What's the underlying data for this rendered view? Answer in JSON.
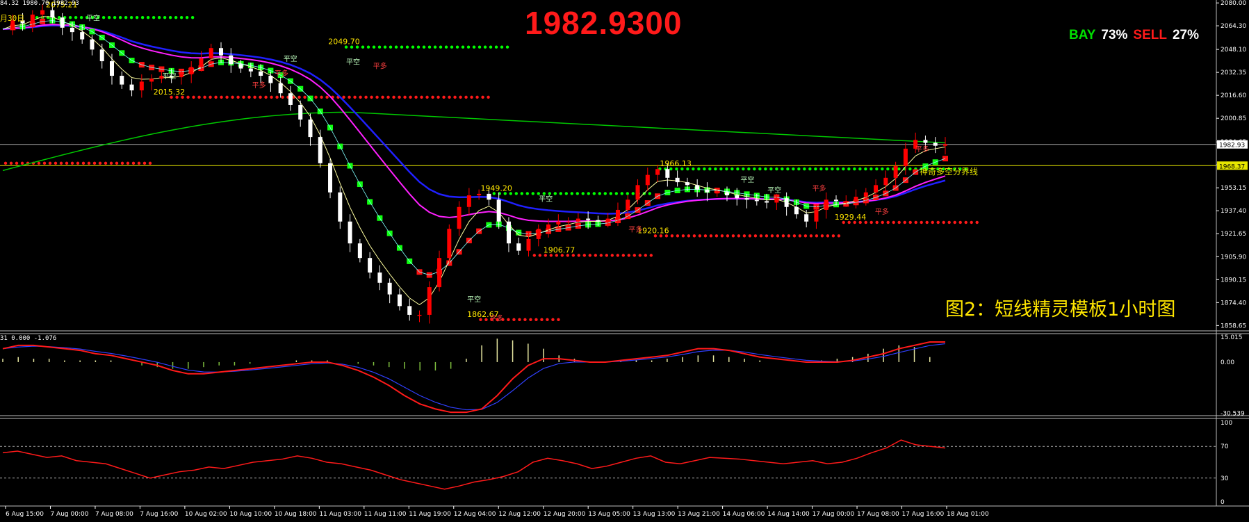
{
  "header": {
    "ohlc_text": "84.32 1980.70 1982.93",
    "date_fragment": "月30日",
    "macd_text": "31 0.000 -1.076"
  },
  "big_price": "1982.9300",
  "sentiment": {
    "buy_label": "BAY",
    "buy_pct": "73%",
    "sell_label": "SELL",
    "sell_pct": "27%",
    "buy_color": "#00e000",
    "sell_color": "#ff1a1a"
  },
  "caption": "图2：短线精灵模板1小时图",
  "colors": {
    "bull": "#ff0000",
    "bear": "#ffffff",
    "grid": "#ffffff",
    "support_dots": "#ff1a1a",
    "resist_dots": "#00ff00",
    "ma_long": "#00c800",
    "ma_blue": "#2020ff",
    "ma_magenta": "#ff20ff",
    "label_text": "#ffe600",
    "axis_text": "#ffffff"
  },
  "chart_data": {
    "main": {
      "type": "candlestick",
      "price_axis_ticks": [
        "2080.00",
        "2064.30",
        "2048.10",
        "2032.35",
        "2016.60",
        "2000.85",
        "1984.65",
        "1968.90",
        "1953.15",
        "1937.40",
        "1921.65",
        "1905.90",
        "1890.15",
        "1874.40",
        "1858.65"
      ],
      "ylim": [
        1855,
        2082
      ],
      "current_price_tag": "1982.93",
      "level_tag": "1968.37",
      "time_labels": [
        "6 Aug 15:00",
        "7 Aug 00:00",
        "7 Aug 08:00",
        "7 Aug 16:00",
        "10 Aug 02:00",
        "10 Aug 10:00",
        "10 Aug 18:00",
        "11 Aug 03:00",
        "11 Aug 11:00",
        "11 Aug 19:00",
        "12 Aug 04:00",
        "12 Aug 12:00",
        "12 Aug 20:00",
        "13 Aug 05:00",
        "13 Aug 13:00",
        "13 Aug 21:00",
        "14 Aug 06:00",
        "14 Aug 14:00",
        "17 Aug 00:00",
        "17 Aug 08:00",
        "17 Aug 16:00",
        "18 Aug 01:00"
      ],
      "price_path": [
        2062,
        2068,
        2066,
        2072,
        2075,
        2070,
        2063,
        2060,
        2055,
        2048,
        2040,
        2030,
        2024,
        2020,
        2026,
        2028,
        2030,
        2029,
        2031,
        2036,
        2042,
        2049,
        2044,
        2038,
        2035,
        2033,
        2030,
        2025,
        2018,
        2010,
        2000,
        1988,
        1970,
        1950,
        1930,
        1915,
        1905,
        1895,
        1888,
        1880,
        1872,
        1866,
        1866,
        1885,
        1905,
        1925,
        1940,
        1948,
        1949,
        1945,
        1930,
        1915,
        1910,
        1918,
        1925,
        1928,
        1930,
        1930,
        1932,
        1931,
        1930,
        1932,
        1938,
        1945,
        1955,
        1962,
        1966,
        1960,
        1957,
        1955,
        1952,
        1950,
        1950,
        1948,
        1946,
        1945,
        1944,
        1943,
        1946,
        1940,
        1935,
        1930,
        1938,
        1945,
        1944,
        1944,
        1947,
        1950,
        1955,
        1960,
        1968,
        1980,
        1986,
        1984,
        1982,
        1983
      ],
      "price_labels": [
        {
          "text": "2075.21",
          "value": 2075
        },
        {
          "text": "2049.70",
          "value": 2049.7
        },
        {
          "text": "2015.32",
          "value": 2015.3
        },
        {
          "text": "1949.20",
          "value": 1949.2
        },
        {
          "text": "1966.13",
          "value": 1966.1
        },
        {
          "text": "1906.77",
          "value": 1906.8
        },
        {
          "text": "1920.16",
          "value": 1920.2
        },
        {
          "text": "1929.44",
          "value": 1929.4
        },
        {
          "text": "1862.67",
          "value": 1862.7
        }
      ],
      "annotations": [
        "平空",
        "平多",
        "平空",
        "平多",
        "平空",
        "平多",
        "平空",
        "平空",
        "平空",
        "平多",
        "平空",
        "平多",
        "平多",
        "平空",
        "平多",
        "平多",
        "神奇多空分界线"
      ],
      "support_lines": [
        {
          "value": 2070,
          "x_from": 0.7,
          "x_to": 4.2,
          "kind": "resistance"
        },
        {
          "value": 2049.7,
          "x_from": 7.6,
          "x_to": 11.2,
          "kind": "resistance"
        },
        {
          "value": 2015.3,
          "x_from": 3.7,
          "x_to": 10.8,
          "kind": "support"
        },
        {
          "value": 1970,
          "x_from": 0,
          "x_to": 3.3,
          "kind": "support"
        },
        {
          "value": 1949.2,
          "x_from": 10.9,
          "x_to": 14.4,
          "kind": "resistance"
        },
        {
          "value": 1966.1,
          "x_from": 14.6,
          "x_to": 21.5,
          "kind": "resistance"
        },
        {
          "value": 1906.8,
          "x_from": 11.8,
          "x_to": 14.5,
          "kind": "support"
        },
        {
          "value": 1920.2,
          "x_from": 14.5,
          "x_to": 18.7,
          "kind": "support"
        },
        {
          "value": 1929.4,
          "x_from": 18.7,
          "x_to": 21.7,
          "kind": "support"
        },
        {
          "value": 1862.7,
          "x_from": 10.6,
          "x_to": 12.4,
          "kind": "support"
        }
      ]
    },
    "macd": {
      "type": "macd",
      "ticks": [
        "15.015",
        "0.00",
        "-30.539"
      ],
      "ylim": [
        -32,
        17
      ],
      "line_values": [
        8,
        10,
        10,
        9,
        8,
        7,
        5,
        4,
        2,
        0,
        -2,
        -5,
        -7,
        -7,
        -6,
        -5,
        -4,
        -3,
        -2,
        -1,
        0,
        0,
        -2,
        -5,
        -9,
        -14,
        -20,
        -25,
        -28,
        -30,
        -30,
        -28,
        -20,
        -10,
        -2,
        2,
        2,
        1,
        0,
        0,
        1,
        2,
        3,
        4,
        6,
        8,
        8,
        7,
        5,
        3,
        2,
        1,
        0,
        0,
        0,
        1,
        3,
        5,
        8,
        10,
        12,
        12
      ],
      "hist_values": [
        2,
        3,
        2,
        2,
        1,
        1,
        1,
        1,
        0,
        -2,
        -3,
        -4,
        -4,
        -3,
        -2,
        -2,
        -1,
        0,
        0,
        1,
        1,
        1,
        0,
        -1,
        -2,
        -3,
        -4,
        -5,
        -5,
        -4,
        2,
        10,
        14,
        13,
        11,
        8,
        4,
        2,
        0,
        0,
        1,
        1,
        1,
        2,
        3,
        4,
        4,
        3,
        2,
        1,
        0,
        0,
        0,
        1,
        2,
        3,
        5,
        8,
        10,
        9,
        3,
        0
      ]
    },
    "rsi": {
      "type": "line",
      "ticks": [
        "100",
        "70",
        "30",
        "0"
      ],
      "ylim": [
        0,
        100
      ],
      "levels": [
        70,
        30
      ],
      "values": [
        62,
        64,
        60,
        56,
        58,
        52,
        50,
        48,
        42,
        36,
        30,
        34,
        38,
        40,
        44,
        42,
        46,
        50,
        52,
        54,
        58,
        55,
        50,
        48,
        44,
        40,
        34,
        28,
        24,
        20,
        16,
        20,
        25,
        28,
        32,
        38,
        50,
        55,
        52,
        48,
        42,
        45,
        50,
        55,
        58,
        50,
        48,
        52,
        56,
        55,
        54,
        52,
        50,
        48,
        50,
        52,
        48,
        50,
        55,
        62,
        68,
        78,
        72,
        70,
        68
      ]
    }
  }
}
